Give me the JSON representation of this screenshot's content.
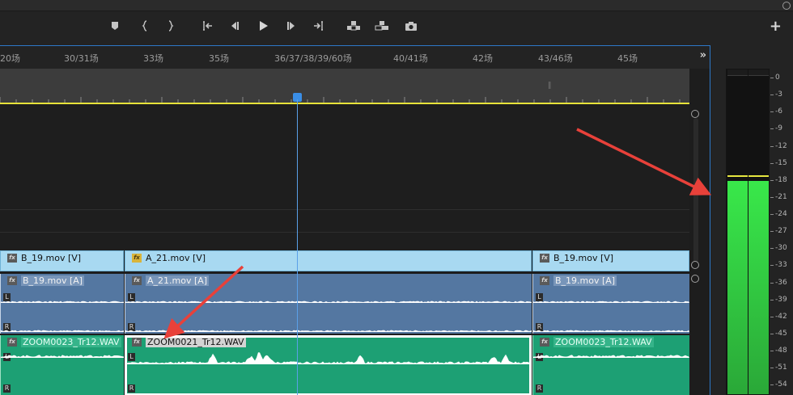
{
  "toolbar": {
    "icons": [
      "add-marker-icon",
      "mark-in-icon",
      "mark-out-icon",
      "go-to-in-icon",
      "step-back-icon",
      "play-icon",
      "step-forward-icon",
      "go-to-out-icon",
      "lift-icon",
      "extract-icon",
      "export-frame-icon"
    ],
    "plus_label": "+"
  },
  "ruler": {
    "markers": [
      "20场",
      "30/31场",
      "33场",
      "35场",
      "36/37/38/39/60场",
      "40/41场",
      "42场",
      "43/46场",
      "45场"
    ],
    "scroll_label": "»"
  },
  "tracks": {
    "video_clips": [
      {
        "label": "B_19.mov [V]",
        "fx": "gray"
      },
      {
        "label": "A_21.mov [V]",
        "fx": "yellow"
      },
      {
        "label": "B_19.mov [V]",
        "fx": "gray"
      }
    ],
    "audio1_clips": [
      {
        "label": "B_19.mov [A]"
      },
      {
        "label": "A_21.mov [A]"
      },
      {
        "label": "B_19.mov [A]"
      }
    ],
    "audio2_clips": [
      {
        "label": "ZOOM0023_Tr12.WAV"
      },
      {
        "label": "ZOOM0021_Tr12.WAV"
      },
      {
        "label": "ZOOM0023_Tr12.WAV"
      }
    ],
    "channel_left": "L",
    "channel_right": "R"
  },
  "meter": {
    "scale": [
      "0",
      "-3",
      "-6",
      "-9",
      "-12",
      "-15",
      "-18",
      "-21",
      "-24",
      "-27",
      "-30",
      "-33",
      "-36",
      "-39",
      "-42",
      "-45",
      "-48",
      "-51",
      "-54"
    ],
    "level_db": -18,
    "peak_db": -17,
    "bar_color": "#39e84a",
    "peak_color": "#e6e640"
  },
  "colors": {
    "video_clip": "#a8d9f1",
    "audio_clip": "#5477a1",
    "audio2_clip": "#1da074",
    "playhead": "#3a8ee6",
    "annotation_arrow": "#e8413a"
  }
}
